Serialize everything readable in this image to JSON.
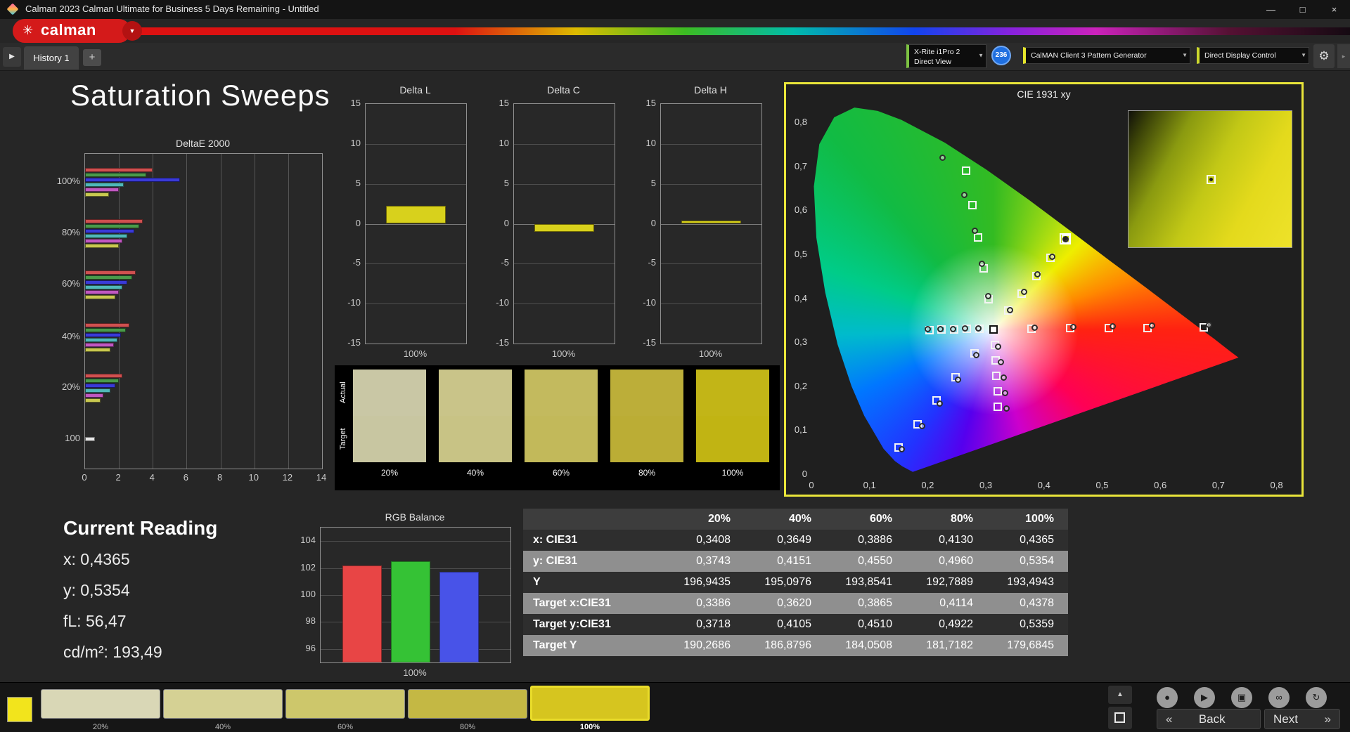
{
  "window": {
    "title": "Calman 2023 Calman Ultimate for Business 5 Days Remaining  - Untitled",
    "controls": {
      "minimize": "—",
      "maximize": "□",
      "close": "×"
    }
  },
  "brand": {
    "logo_text": "calman",
    "logo_flower": "✳",
    "dropdown_glyph": "▼"
  },
  "tab_bar": {
    "nav_glyph": "▶",
    "history_tab": "History 1",
    "add_tab": "+"
  },
  "device_bar": {
    "meter_line1": "X-Rite i1Pro 2",
    "meter_line2": "Direct View",
    "badge": "236",
    "pattern_generator": "CalMAN Client 3 Pattern Generator",
    "display_control": "Direct Display Control",
    "settings_glyph": "⚙",
    "dropdown_glyph": "▼",
    "overflow_glyph": "▸"
  },
  "page": {
    "title": "Saturation Sweeps"
  },
  "current_reading": {
    "title": "Current Reading",
    "lines": [
      "x: 0,4365",
      "y: 0,5354",
      "fL: 56,47",
      "cd/m²: 193,49"
    ]
  },
  "swatch_strip": {
    "actual_label": "Actual",
    "target_label": "Target",
    "columns": [
      {
        "label": "20%",
        "actual": "#c9c7a5",
        "target": "#c8c6a1"
      },
      {
        "label": "40%",
        "actual": "#c9c489",
        "target": "#c8c385"
      },
      {
        "label": "60%",
        "actual": "#c3ba5e",
        "target": "#c2b95a"
      },
      {
        "label": "80%",
        "actual": "#bcae39",
        "target": "#bbad35"
      },
      {
        "label": "100%",
        "actual": "#c2b517",
        "target": "#c1b413"
      }
    ]
  },
  "table": {
    "columns": [
      "",
      "20%",
      "40%",
      "60%",
      "80%",
      "100%"
    ],
    "rows": [
      {
        "label": "x: CIE31",
        "values": [
          "0,3408",
          "0,3649",
          "0,3886",
          "0,4130",
          "0,4365"
        ]
      },
      {
        "label": "y: CIE31",
        "values": [
          "0,3743",
          "0,4151",
          "0,4550",
          "0,4960",
          "0,5354"
        ]
      },
      {
        "label": "Y",
        "values": [
          "196,9435",
          "195,0976",
          "193,8541",
          "192,7889",
          "193,4943"
        ]
      },
      {
        "label": "Target x:CIE31",
        "values": [
          "0,3386",
          "0,3620",
          "0,3865",
          "0,4114",
          "0,4378"
        ]
      },
      {
        "label": "Target y:CIE31",
        "values": [
          "0,3718",
          "0,4105",
          "0,4510",
          "0,4922",
          "0,5359"
        ]
      },
      {
        "label": "Target Y",
        "values": [
          "190,2686",
          "186,8796",
          "184,0508",
          "181,7182",
          "179,6845"
        ]
      }
    ]
  },
  "bottom_bar": {
    "mini_swatch_color": "#f2e41c",
    "thumbnails": [
      {
        "label": "20%",
        "color": "#d9d7b6",
        "selected": false
      },
      {
        "label": "40%",
        "color": "#d5d194",
        "selected": false
      },
      {
        "label": "60%",
        "color": "#cdc76b",
        "selected": false
      },
      {
        "label": "80%",
        "color": "#c4b844",
        "selected": false
      },
      {
        "label": "100%",
        "color": "#d6c51f",
        "selected": true
      }
    ],
    "toolbar_icons": [
      {
        "name": "record-icon",
        "glyph": "●"
      },
      {
        "name": "play-icon",
        "glyph": "▶"
      },
      {
        "name": "save-icon",
        "glyph": "▣"
      },
      {
        "name": "link-icon",
        "glyph": "∞"
      },
      {
        "name": "refresh-icon",
        "glyph": "↻"
      }
    ],
    "collapse_glyph": "▲",
    "back_chevron": "«",
    "back_label": "Back",
    "next_label": "Next",
    "next_chevron": "»"
  },
  "chart_data": [
    {
      "id": "deltae2000",
      "type": "bar",
      "orientation": "horizontal",
      "title": "DeltaE 2000",
      "group_labels": [
        "100%",
        "80%",
        "60%",
        "40%",
        "20%",
        "100"
      ],
      "bar_colors": [
        "#d05050",
        "#4a9a4a",
        "#3a3ad8",
        "#50b8b8",
        "#c058c0",
        "#c8c850"
      ],
      "groups": [
        [
          4.0,
          3.6,
          5.6,
          2.3,
          2.0,
          1.4
        ],
        [
          3.4,
          3.2,
          2.9,
          2.5,
          2.2,
          2.0
        ],
        [
          3.0,
          2.8,
          2.5,
          2.2,
          2.0,
          1.8
        ],
        [
          2.6,
          2.4,
          2.1,
          1.9,
          1.7,
          1.5
        ],
        [
          2.2,
          2.0,
          1.8,
          1.5,
          1.1,
          0.9
        ],
        [
          0.6
        ]
      ],
      "last_group_color": "#e8e8e8",
      "xlim": [
        0,
        14
      ],
      "xticks": [
        0,
        2,
        4,
        6,
        8,
        10,
        12,
        14
      ]
    },
    {
      "id": "delta_l",
      "type": "bar",
      "title": "Delta L",
      "categories": [
        "100%"
      ],
      "values": [
        2.2
      ],
      "ylim": [
        -15,
        15
      ],
      "yticks": [
        15,
        10,
        5,
        0,
        -5,
        -10,
        -15
      ],
      "bar_color": "#d8d11c",
      "xlabel": "100%"
    },
    {
      "id": "delta_c",
      "type": "bar",
      "title": "Delta C",
      "categories": [
        "100%"
      ],
      "values": [
        -1.0
      ],
      "ylim": [
        -15,
        15
      ],
      "yticks": [
        15,
        10,
        5,
        0,
        -5,
        -10,
        -15
      ],
      "bar_color": "#d8d11c",
      "xlabel": "100%"
    },
    {
      "id": "delta_h",
      "type": "bar",
      "title": "Delta H",
      "categories": [
        "100%"
      ],
      "values": [
        0.4
      ],
      "ylim": [
        -15,
        15
      ],
      "yticks": [
        15,
        10,
        5,
        0,
        -5,
        -10,
        -15
      ],
      "bar_color": "#d8d11c",
      "xlabel": "100%"
    },
    {
      "id": "rgb_balance",
      "type": "bar",
      "title": "RGB Balance",
      "categories": [
        "Red",
        "Green",
        "Blue"
      ],
      "values": [
        102.2,
        102.5,
        101.7
      ],
      "colors": [
        "#e84545",
        "#35c235",
        "#4853e8"
      ],
      "ylim": [
        95,
        105
      ],
      "yticks": [
        104,
        102,
        100,
        98,
        96
      ],
      "xlabel": "100%"
    },
    {
      "id": "cie1931",
      "type": "scatter",
      "title": "CIE 1931 xy",
      "xlim": [
        0,
        0.8
      ],
      "ylim": [
        0,
        0.8
      ],
      "xtick_labels": [
        "0",
        "0,1",
        "0,2",
        "0,3",
        "0,4",
        "0,5",
        "0,6",
        "0,7",
        "0,8"
      ],
      "ytick_labels": [
        "0",
        "0,1",
        "0,2",
        "0,3",
        "0,4",
        "0,5",
        "0,6",
        "0,7",
        "0,8"
      ],
      "white_point": [
        0.3127,
        0.329
      ],
      "targets": [
        [
          0.379,
          0.331
        ],
        [
          0.445,
          0.332
        ],
        [
          0.512,
          0.332
        ],
        [
          0.578,
          0.333
        ],
        [
          0.675,
          0.334
        ],
        [
          0.289,
          0.33
        ],
        [
          0.267,
          0.33
        ],
        [
          0.246,
          0.329
        ],
        [
          0.224,
          0.329
        ],
        [
          0.203,
          0.328
        ],
        [
          0.305,
          0.398
        ],
        [
          0.296,
          0.468
        ],
        [
          0.287,
          0.538
        ],
        [
          0.277,
          0.612
        ],
        [
          0.266,
          0.69
        ],
        [
          0.28,
          0.275
        ],
        [
          0.248,
          0.221
        ],
        [
          0.215,
          0.168
        ],
        [
          0.183,
          0.114
        ],
        [
          0.15,
          0.06
        ],
        [
          0.315,
          0.294
        ],
        [
          0.317,
          0.259
        ],
        [
          0.318,
          0.224
        ],
        [
          0.32,
          0.189
        ],
        [
          0.321,
          0.154
        ],
        [
          0.3386,
          0.3718
        ],
        [
          0.362,
          0.4105
        ],
        [
          0.3865,
          0.451
        ],
        [
          0.4114,
          0.4922
        ],
        [
          0.4378,
          0.5359
        ]
      ],
      "measured": [
        [
          0.383,
          0.334
        ],
        [
          0.45,
          0.336
        ],
        [
          0.518,
          0.337
        ],
        [
          0.585,
          0.338
        ],
        [
          0.683,
          0.34
        ],
        [
          0.287,
          0.332
        ],
        [
          0.264,
          0.332
        ],
        [
          0.243,
          0.331
        ],
        [
          0.221,
          0.331
        ],
        [
          0.2,
          0.33
        ],
        [
          0.303,
          0.405
        ],
        [
          0.293,
          0.48
        ],
        [
          0.281,
          0.555
        ],
        [
          0.262,
          0.635
        ],
        [
          0.225,
          0.72
        ],
        [
          0.283,
          0.272
        ],
        [
          0.252,
          0.216
        ],
        [
          0.22,
          0.162
        ],
        [
          0.19,
          0.11
        ],
        [
          0.155,
          0.058
        ],
        [
          0.32,
          0.29
        ],
        [
          0.325,
          0.255
        ],
        [
          0.33,
          0.22
        ],
        [
          0.333,
          0.185
        ],
        [
          0.335,
          0.15
        ],
        [
          0.3408,
          0.3743
        ],
        [
          0.3649,
          0.4151
        ],
        [
          0.3886,
          0.455
        ],
        [
          0.413,
          0.496
        ],
        [
          0.4365,
          0.5354
        ]
      ],
      "current": [
        0.4365,
        0.5354
      ]
    }
  ]
}
